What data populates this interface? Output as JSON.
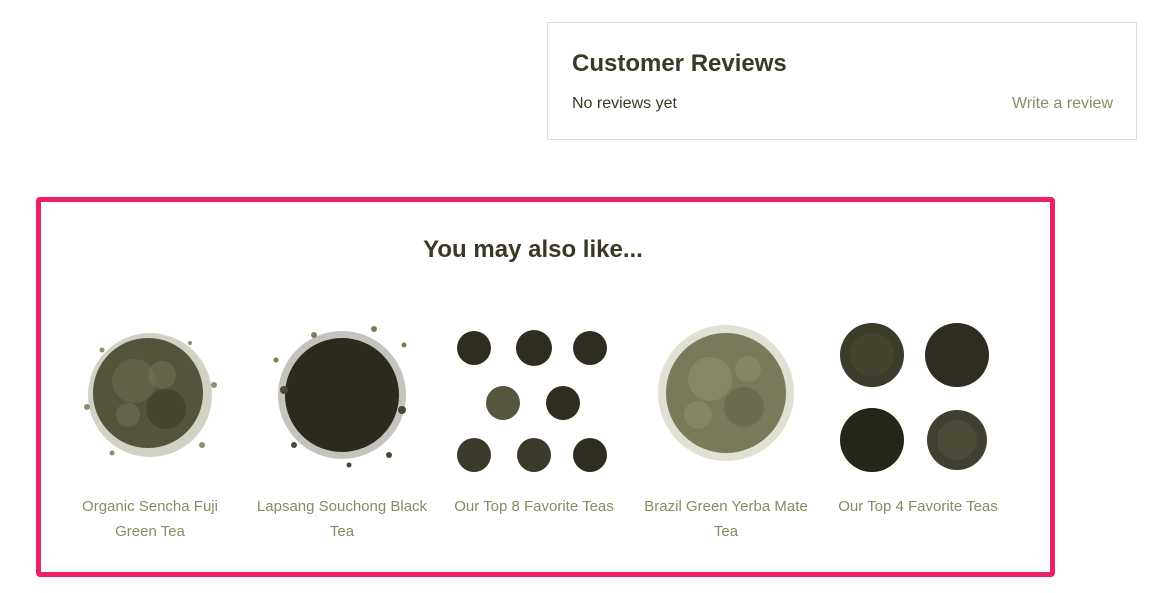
{
  "reviews": {
    "title": "Customer Reviews",
    "empty_text": "No reviews yet",
    "write_link": "Write a review"
  },
  "related": {
    "title": "You may also like...",
    "products": [
      {
        "name": "Organic Sencha Fuji Green Tea"
      },
      {
        "name": "Lapsang Souchong Black Tea"
      },
      {
        "name": "Our Top 8 Favorite Teas"
      },
      {
        "name": "Brazil Green Yerba Mate Tea"
      },
      {
        "name": "Our Top 4 Favorite Teas"
      }
    ]
  },
  "colors": {
    "heading": "#3b3926",
    "link": "#8a8a63",
    "highlight_border": "#ee1f64",
    "box_border": "#dcdcdc"
  }
}
